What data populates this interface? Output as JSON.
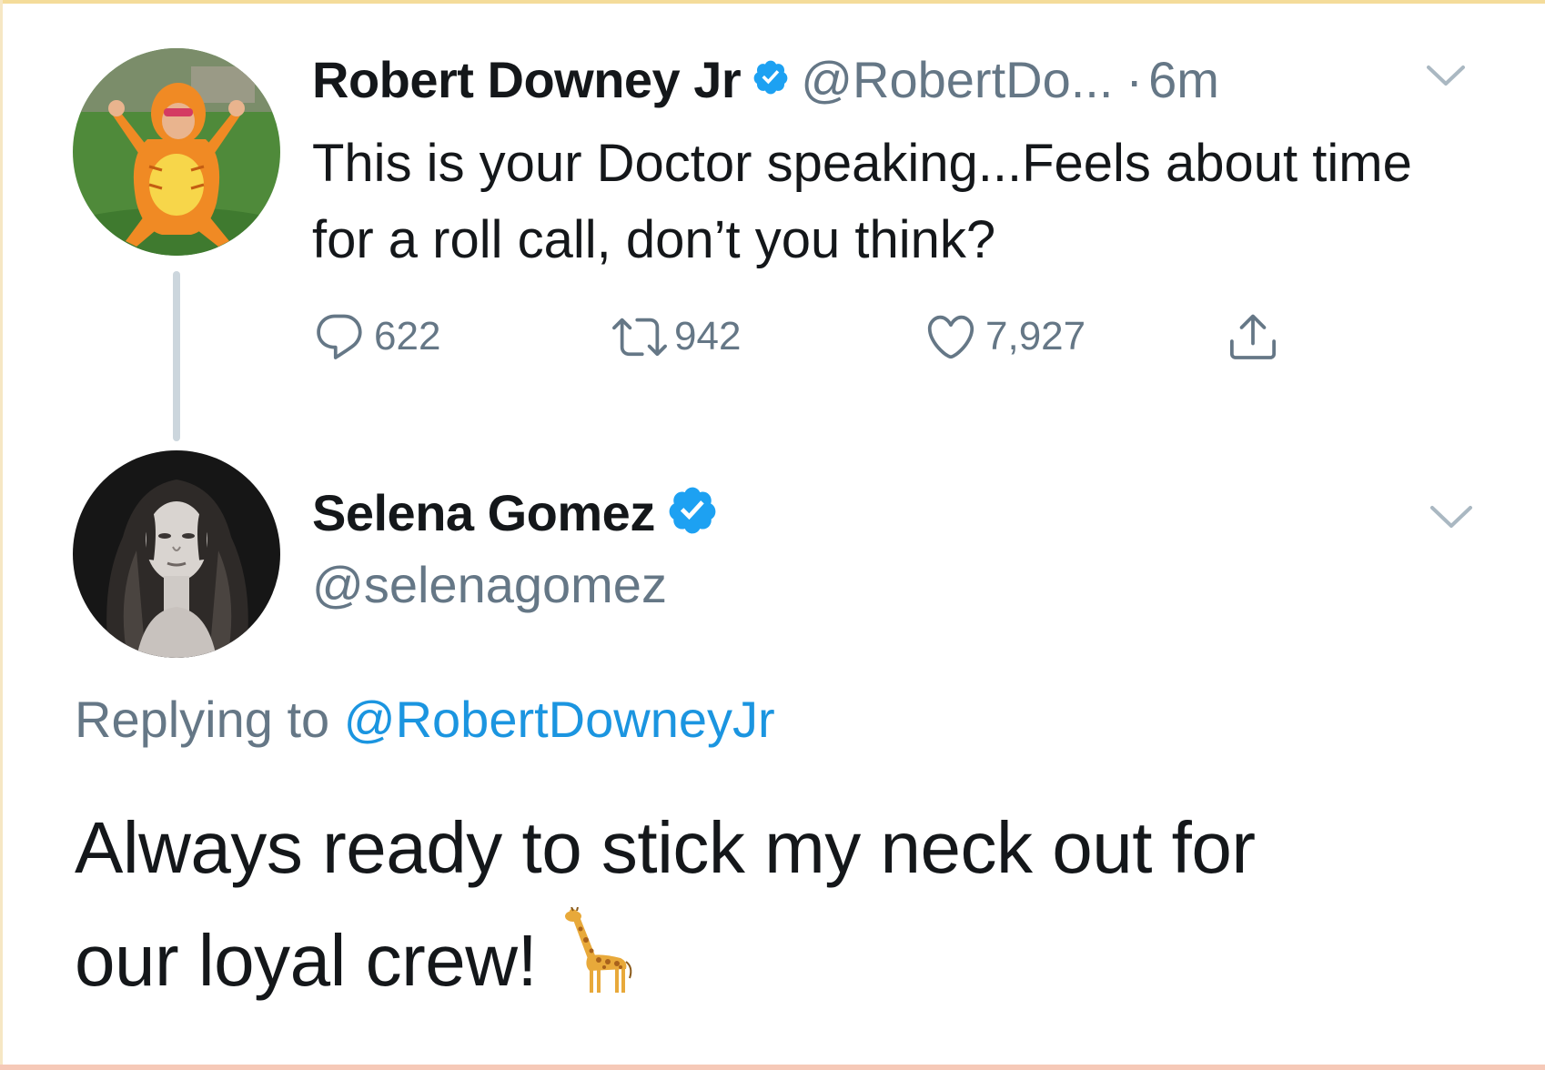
{
  "tweet1": {
    "display_name": "Robert Downey Jr",
    "handle": "@RobertDo...",
    "separator": "·",
    "time": "6m",
    "text": "This is your Doctor speaking...Feels about time for a roll call, don’t you think?",
    "stats": {
      "replies": "622",
      "retweets": "942",
      "likes": "7,927"
    },
    "verified": true
  },
  "tweet2": {
    "display_name": "Selena Gomez",
    "handle": "@selenagomez",
    "reply_prefix": "Replying to",
    "reply_mention": "@RobertDowneyJr",
    "text_line1": "Always ready to stick my neck out for",
    "text_line2": "our loyal crew!",
    "emoji": "giraffe-icon",
    "verified": true
  },
  "colors": {
    "primary_text": "#14171a",
    "secondary_text": "#657786",
    "link": "#1b95e0",
    "verified_blue": "#1da1f2",
    "thread_line": "#ccd6dd"
  },
  "icons": {
    "reply": "reply-icon",
    "retweet": "retweet-icon",
    "like": "heart-icon",
    "share": "share-icon",
    "menu": "chevron-down-icon"
  }
}
